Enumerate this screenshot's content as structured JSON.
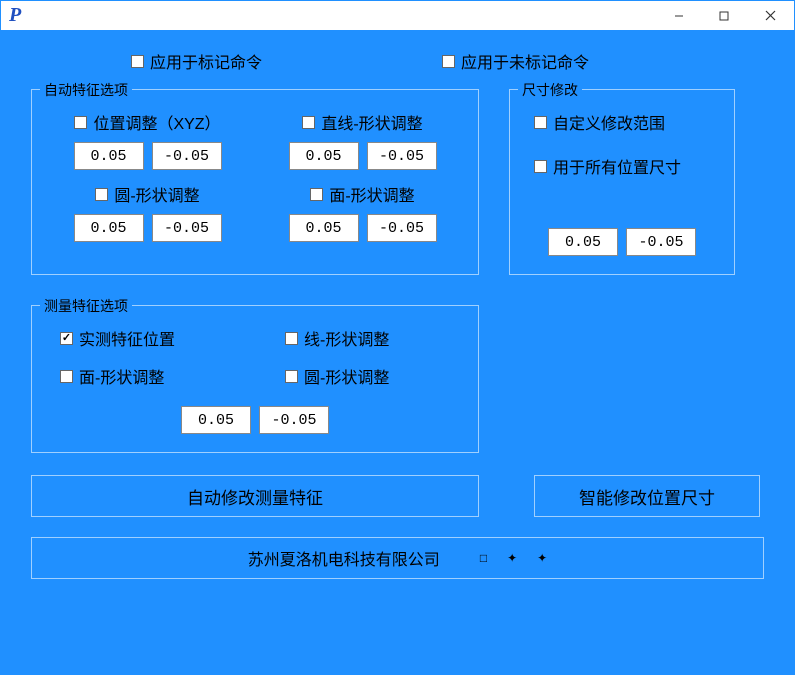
{
  "titlebar": {
    "icon_text": "P"
  },
  "top_checks": {
    "apply_marked": "应用于标记命令",
    "apply_unmarked": "应用于未标记命令"
  },
  "auto_feature": {
    "legend": "自动特征选项",
    "position_xyz": "位置调整（XYZ）",
    "line_shape": "直线-形状调整",
    "circle_shape": "圆-形状调整",
    "plane_shape": "面-形状调整",
    "pos_val": "0.05",
    "neg_val": "-0.05"
  },
  "dim_modify": {
    "legend": "尺寸修改",
    "custom_range": "自定义修改范围",
    "all_positions": "用于所有位置尺寸",
    "pos_val": "0.05",
    "neg_val": "-0.05"
  },
  "measure_feature": {
    "legend": "测量特征选项",
    "actual_position": "实测特征位置",
    "line_shape": "线-形状调整",
    "plane_shape": "面-形状调整",
    "circle_shape": "圆-形状调整",
    "pos_val": "0.05",
    "neg_val": "-0.05"
  },
  "actions": {
    "auto_modify_measure": "自动修改测量特征",
    "smart_modify_position": "智能修改位置尺寸"
  },
  "footer": {
    "company": "苏州夏洛机电科技有限公司"
  }
}
